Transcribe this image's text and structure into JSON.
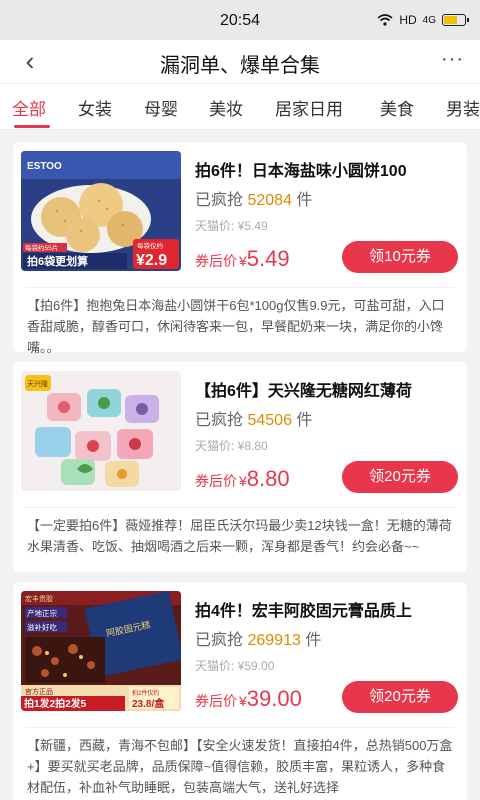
{
  "status": {
    "time": "20:54",
    "network": "HD",
    "signal_label": "4G",
    "battery_level": 0.7
  },
  "nav": {
    "title": "漏洞单、爆单合集",
    "back_icon": "chevron-left-icon",
    "more_icon": "more-icon"
  },
  "tabs": [
    {
      "label": "全部",
      "active": true
    },
    {
      "label": "女装"
    },
    {
      "label": "母婴"
    },
    {
      "label": "美妆"
    },
    {
      "label": "居家日用"
    },
    {
      "label": "美食"
    },
    {
      "label": "男装"
    }
  ],
  "colors": {
    "accent": "#e8364b",
    "sold_count": "#e08a00"
  },
  "sold_prefix": "已疯抢",
  "sold_suffix": "件",
  "after_label": "券后价",
  "currency": "¥",
  "products": [
    {
      "title": "拍6件！日本海盐味小圆饼100",
      "sold": "52084",
      "tmall": "天猫价: ¥5.49",
      "price": "5.49",
      "coupon": "领10元券",
      "desc": "【拍6件】抱抱兔日本海盐小圆饼干6包*100g仅售9.9元，可盐可甜，入口香甜咸脆，醇香可口，休闲待客来一包，早餐配奶来一块，满足你的小馋嘴。。",
      "img": {
        "brand": "ESTOO",
        "promo_text": "拍6袋更划算",
        "badge_label": "每袋仅约",
        "badge_price": "¥2.9",
        "tag": "每袋约55片"
      }
    },
    {
      "title": "【拍6件】天兴隆无糖网红薄荷",
      "sold": "54506",
      "tmall": "天猫价: ¥8.80",
      "price": "8.80",
      "coupon": "领20元券",
      "desc": "【一定要拍6件】薇娅推荐！屈臣氏沃尔玛最少卖12块钱一盒！无糖的薄荷水果清香、吃饭、抽烟喝酒之后来一颗，浑身都是香气！约会必备~~",
      "img": {
        "brand": "天兴隆"
      }
    },
    {
      "title": "拍4件！宏丰阿胶固元膏品质上",
      "sold": "269913",
      "tmall": "天猫价: ¥59.00",
      "price": "39.00",
      "coupon": "领20元券",
      "desc": "【新疆，西藏，青海不包邮】【安全火速发货！直接拍4件，总热销500万盒+】要买就买老品牌，品质保障~值得信赖，胶质丰富，果粒诱人，多种食材配伍，补血补气助睡眠，包装高端大气，送礼好选择",
      "img": {
        "tag1": "宏丰贵胶",
        "tag2": "产地正宗",
        "tag3": "滋补好吃",
        "tag4": "官方正品",
        "tag5": "拍1发2拍2发5",
        "badge": "拍2件仅约",
        "badge_price": "23.8/盒",
        "box_text": "阿胶固元糕"
      }
    }
  ]
}
